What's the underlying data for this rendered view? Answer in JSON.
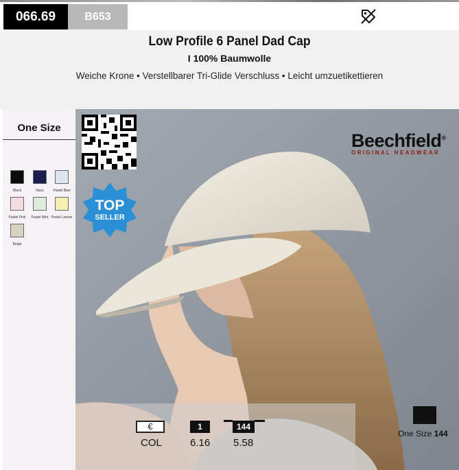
{
  "header": {
    "article_code": "066.69",
    "sku": "B653",
    "tag_icon": "no-tag-icon"
  },
  "product": {
    "title": "Low Profile 6 Panel Dad Cap",
    "subtitle": "I 100% Baumwolle",
    "description": "Weiche Krone • Verstellbarer Tri-Glide Verschluss • Leicht umzuetikettieren"
  },
  "sidebar": {
    "size_label": "One Size",
    "colors": [
      {
        "name": "Black",
        "hex": "#0b0b0b"
      },
      {
        "name": "Navy",
        "hex": "#1a1d4e"
      },
      {
        "name": "Pastel Blue",
        "hex": "#dde6ee"
      },
      {
        "name": "Pastel Pink",
        "hex": "#f3dde0"
      },
      {
        "name": "Pastel Mint",
        "hex": "#dbecd9"
      },
      {
        "name": "Pastel Lemon",
        "hex": "#f6eeb5"
      },
      {
        "name": "Beige",
        "hex": "#d9d3c4"
      }
    ]
  },
  "badge": {
    "line1": "TOP",
    "line2": "SELLER",
    "color": "#2a8fd4"
  },
  "brand": {
    "name": "Beechfield",
    "trademark": "®",
    "tagline": "ORIGINAL HEADWEAR"
  },
  "pricing": {
    "currency": "€",
    "qty_1": "1",
    "qty_2": "144",
    "row_label": "COL",
    "price_1": "6.16",
    "price_2": "5.58"
  },
  "packaging": {
    "size": "One Size",
    "count": "144"
  }
}
